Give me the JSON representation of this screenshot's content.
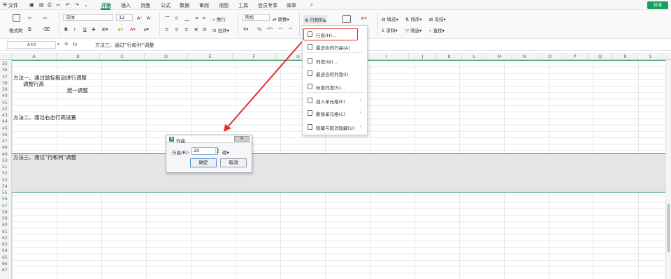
{
  "menubar": {
    "file_label": "文件",
    "tabs": [
      "开始",
      "插入",
      "页面",
      "公式",
      "数据",
      "审阅",
      "视图",
      "工具",
      "会员专享",
      "效率"
    ],
    "active_tab": "开始",
    "share_label": "分享"
  },
  "ribbon": {
    "paste_label": "格式刷",
    "font_name": "宋体",
    "font_size": "12",
    "wrap_label": "换行",
    "merge_label": "合并",
    "number_format": "常规",
    "convert_label": "转换",
    "row_col_label": "行和列",
    "fill_label": "填充",
    "sort_label": "排序",
    "freeze_label": "冻结",
    "sum_label": "求和",
    "filter_label": "筛选",
    "find_label": "查找",
    "bold": "B",
    "italic": "I",
    "underline": "U",
    "strike": "S"
  },
  "formula_bar": {
    "cell_ref": "A49",
    "fx": "fx",
    "content": "方法三、通过“行和列”调整"
  },
  "columns": [
    "A",
    "B",
    "C",
    "D",
    "E",
    "F",
    "G",
    "H",
    "I",
    "J",
    "K",
    "L",
    "M",
    "N",
    "O",
    "P",
    "Q",
    "R",
    "S"
  ],
  "rows": [
    "35",
    "36",
    "37",
    "38",
    "39",
    "40",
    "41",
    "42",
    "43",
    "44",
    "45",
    "46",
    "47",
    "48",
    "49",
    "50",
    "51",
    "52",
    "53",
    "54",
    "55",
    "56",
    "57",
    "58",
    "59",
    "60",
    "61",
    "62",
    "63",
    "64",
    "65",
    "66",
    "67"
  ],
  "cells": {
    "r36": "方法一、通过鼠标拖动进行调整",
    "r37": "调整行高",
    "r38": "统一调整",
    "r41": "方法二、通过右击行高设置",
    "r49": "方法三、通过“行和列”调整"
  },
  "dropdown": {
    "items": [
      {
        "label": "行高(H)...",
        "icon": "row-height-icon",
        "has_submenu": false
      },
      {
        "label": "最适合的行高(A)",
        "icon": "autofit-row-icon",
        "has_submenu": false
      },
      {
        "label": "列宽(W)...",
        "icon": "column-width-icon",
        "has_submenu": false
      },
      {
        "label": "最适合的列宽(I)",
        "icon": "autofit-column-icon",
        "has_submenu": false
      },
      {
        "label": "标准列宽(S)...",
        "icon": "standard-width-icon",
        "has_submenu": false
      },
      {
        "label": "插入单元格(E)",
        "icon": "insert-cell-icon",
        "has_submenu": true
      },
      {
        "label": "删除单元格(C)",
        "icon": "delete-cell-icon",
        "has_submenu": true
      },
      {
        "label": "隐藏与取消隐藏(U)",
        "icon": "hide-show-icon",
        "has_submenu": true
      }
    ]
  },
  "dialog": {
    "logo": "S",
    "title": "行高",
    "field_label": "行高(R):",
    "value": "20",
    "unit": "磅",
    "ok_label": "确定",
    "cancel_label": "取消",
    "close_label": "✕"
  },
  "colors": {
    "accent": "#0f7d4b",
    "share_bg": "#17a05d",
    "selection_border": "#1f8f4e",
    "annotation_red": "#e2312b"
  }
}
